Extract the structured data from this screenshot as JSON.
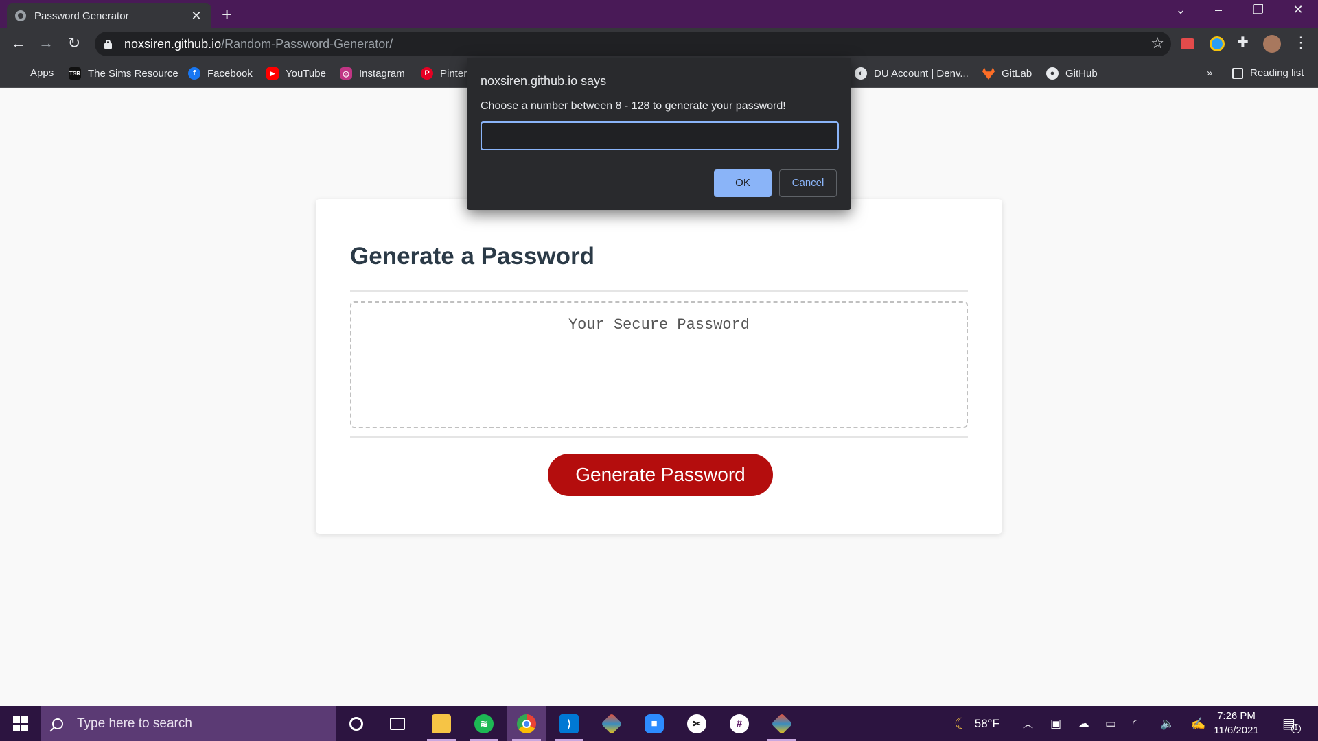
{
  "browser": {
    "tab_title": "Password Generator",
    "tab_close": "✕",
    "new_tab": "+",
    "url_host": "noxsiren.github.io",
    "url_path": "/Random-Password-Generator/",
    "star": "☆",
    "win_controls": {
      "dropdown": "⌄",
      "minimize": "–",
      "restore": "❐",
      "close": "✕"
    },
    "nav": {
      "back": "←",
      "forward": "→",
      "reload": "↻"
    },
    "menu": "⋮"
  },
  "bookmarks": {
    "items": [
      {
        "label": "Apps",
        "icon": "apps-grid-icon"
      },
      {
        "label": "The Sims Resource",
        "icon": "tsr-icon"
      },
      {
        "label": "Facebook",
        "icon": "facebook-icon"
      },
      {
        "label": "YouTube",
        "icon": "youtube-icon"
      },
      {
        "label": "Instagram",
        "icon": "instagram-icon"
      },
      {
        "label": "Pinter",
        "icon": "pinterest-icon"
      },
      {
        "label": "DU Account | Denv...",
        "icon": "globe-icon"
      },
      {
        "label": "GitLab",
        "icon": "gitlab-icon"
      },
      {
        "label": "GitHub",
        "icon": "github-icon"
      }
    ],
    "overflow": "»",
    "reading_list": "Reading list"
  },
  "page": {
    "title": "Generate a Password",
    "password_placeholder": "Your Secure Password",
    "generate_button": "Generate Password"
  },
  "dialog": {
    "title": "noxsiren.github.io says",
    "message": "Choose a number between 8 - 128 to generate your password!",
    "input_value": "",
    "ok_label": "OK",
    "cancel_label": "Cancel"
  },
  "taskbar": {
    "search_placeholder": "Type here to search",
    "weather": "58°F",
    "time": "7:26 PM",
    "date": "11/6/2021",
    "notification_count": "1"
  },
  "colors": {
    "tabbar": "#491a57",
    "toolbar": "#35363a",
    "generate_button": "#b40d0d",
    "dialog_accent": "#8ab4f8",
    "taskbar": "#2c1440"
  }
}
